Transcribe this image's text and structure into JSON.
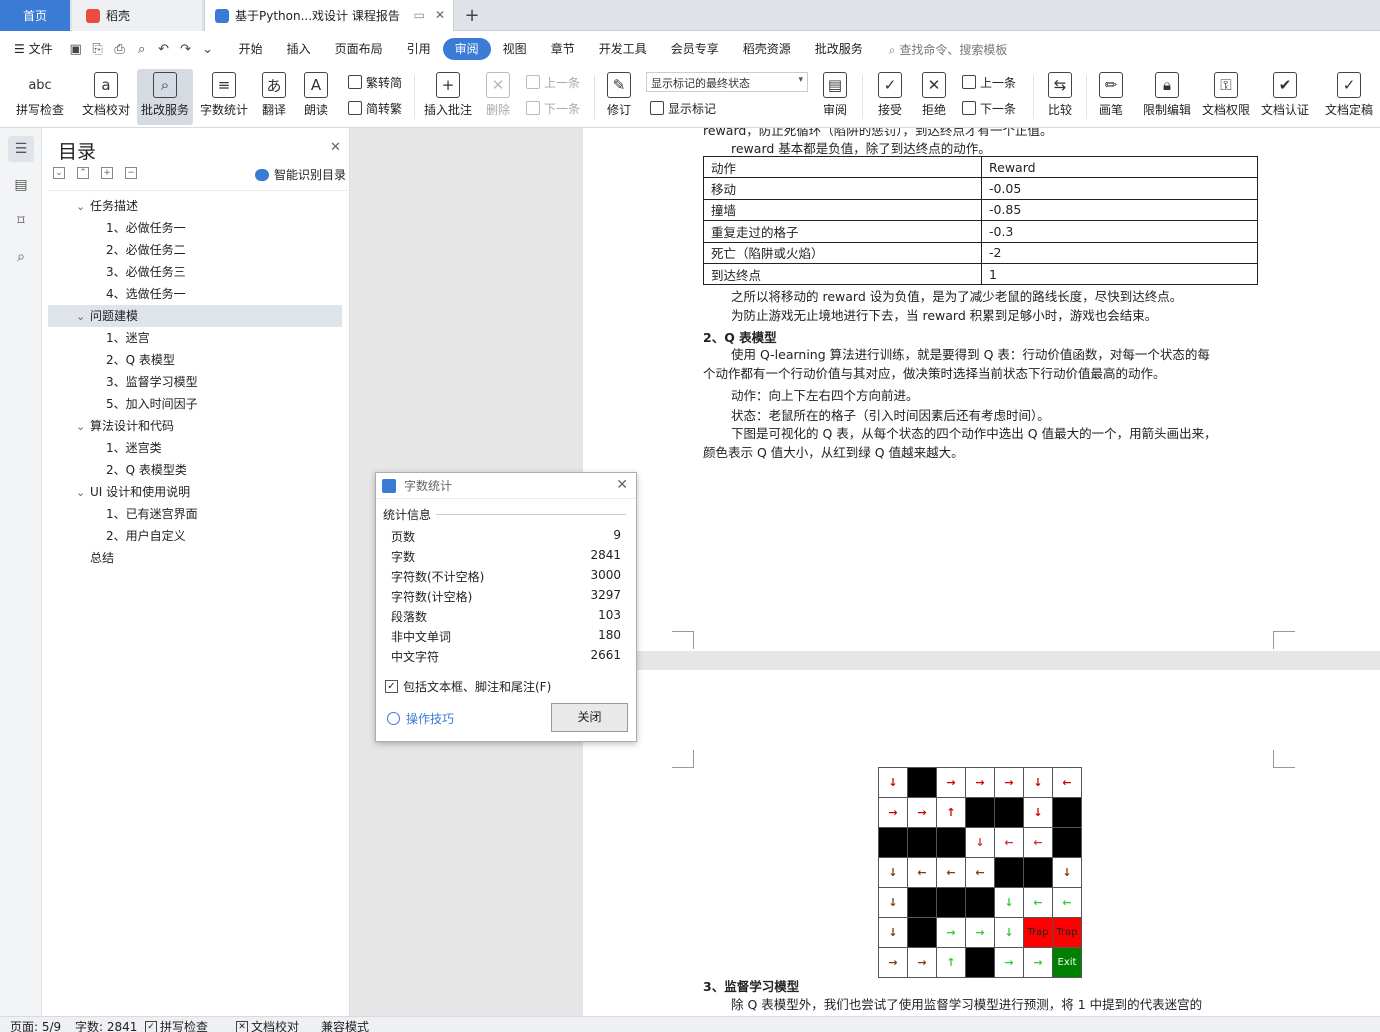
{
  "tabs": {
    "home": "首页",
    "daoke": "稻壳",
    "doc": "基于Python...戏设计 课程报告"
  },
  "menu": {
    "file": "文件",
    "items": [
      "开始",
      "插入",
      "页面布局",
      "引用",
      "审阅",
      "视图",
      "章节",
      "开发工具",
      "会员专享",
      "稻壳资源",
      "批改服务"
    ],
    "active": "审阅",
    "search": "查找命令、搜索模板"
  },
  "ribbon": {
    "spell": "拼写检查",
    "proof": "文档校对",
    "correct": "批改服务",
    "wordcount": "字数统计",
    "translate": "翻译",
    "read": "朗读",
    "trad": "繁转简",
    "simp": "简转繁",
    "insert_comment": "插入批注",
    "delete": "删除",
    "prev_comment": "上一条",
    "next_comment": "下一条",
    "track": "修订",
    "markup_select": "显示标记的最终状态",
    "show_markup": "显示标记",
    "review": "审阅",
    "accept": "接受",
    "reject": "拒绝",
    "prev": "上一条",
    "next": "下一条",
    "compare": "比较",
    "pen": "画笔",
    "restrict": "限制编辑",
    "perm": "文档权限",
    "cert": "文档认证",
    "final": "文档定稿"
  },
  "toc": {
    "title": "目录",
    "smart": "智能识别目录",
    "items": [
      {
        "label": "任务描述",
        "level": 1
      },
      {
        "label": "1、必做任务一",
        "level": 2
      },
      {
        "label": "2、必做任务二",
        "level": 2
      },
      {
        "label": "3、必做任务三",
        "level": 2
      },
      {
        "label": "4、选做任务一",
        "level": 2
      },
      {
        "label": "问题建模",
        "level": 1
      },
      {
        "label": "1、迷宫",
        "level": 2
      },
      {
        "label": "2、Q 表模型",
        "level": 2
      },
      {
        "label": "3、监督学习模型",
        "level": 2
      },
      {
        "label": "5、加入时间因子",
        "level": 2
      },
      {
        "label": "算法设计和代码",
        "level": 1
      },
      {
        "label": "1、迷宫类",
        "level": 2
      },
      {
        "label": "2、Q 表模型类",
        "level": 2
      },
      {
        "label": "UI 设计和使用说明",
        "level": 1
      },
      {
        "label": "1、已有迷宫界面",
        "level": 2
      },
      {
        "label": "2、用户自定义",
        "level": 2
      },
      {
        "label": "总结",
        "level": 0
      }
    ]
  },
  "doc": {
    "cut_line": "reward，防止死循环（陷阱的惩罚），到达终点才有一个正值。",
    "line1": "reward 基本都是负值，除了到达终点的动作。",
    "table": [
      [
        "动作",
        "Reward"
      ],
      [
        "移动",
        "-0.05"
      ],
      [
        "撞墙",
        "-0.85"
      ],
      [
        "重复走过的格子",
        "-0.3"
      ],
      [
        "死亡（陷阱或火焰）",
        "-2"
      ],
      [
        "到达终点",
        "1"
      ]
    ],
    "p_after_table": "之所以将移动的 reward 设为负值，是为了减少老鼠的路线长度，尽快到达终点。",
    "p_loop": "为防止游戏无止境地进行下去，当 reward 积累到足够小时，游戏也会结束。",
    "h2": "2、Q 表模型",
    "q1a": "使用 Q-learning 算法进行训练，就是要得到 Q 表：行动价值函数，对每一个状态的每",
    "q1b": "个动作都有一个行动价值与其对应，做决策时选择当前状态下行动价值最高的动作。",
    "q2": "动作：向上下左右四个方向前进。",
    "q3": "状态：老鼠所在的格子（引入时间因素后还有考虑时间）。",
    "q4a": "下图是可视化的 Q 表，从每个状态的四个动作中选出 Q 值最大的一个，用箭头画出来，",
    "q4b": "颜色表示 Q 值大小，从红到绿 Q 值越来越大。",
    "h3": "3、监督学习模型",
    "last": "除 Q 表模型外，我们也尝试了使用监督学习模型进行预测，将 1 中提到的代表迷宫的"
  },
  "maze": {
    "trap_label": "Trap",
    "exit_label": "Exit",
    "rows": [
      [
        [
          "↓",
          "#c00"
        ],
        [
          "W"
        ],
        [
          "→",
          "#c00"
        ],
        [
          "→",
          "#c00"
        ],
        [
          "→",
          "#c00"
        ],
        [
          "↓",
          "#c00"
        ],
        [
          "←",
          "#c00"
        ]
      ],
      [
        [
          "→",
          "#c00"
        ],
        [
          "→",
          "#c00"
        ],
        [
          "↑",
          "#c00"
        ],
        [
          "W"
        ],
        [
          "W"
        ],
        [
          "↓",
          "#c00"
        ],
        [
          "W"
        ]
      ],
      [
        [
          "W"
        ],
        [
          "W"
        ],
        [
          "W"
        ],
        [
          "↓",
          "#c33"
        ],
        [
          "←",
          "#c33"
        ],
        [
          "←",
          "#c33"
        ],
        [
          "W"
        ]
      ],
      [
        [
          "↓",
          "#8a3a00"
        ],
        [
          "←",
          "#8a3a00"
        ],
        [
          "←",
          "#8a3a00"
        ],
        [
          "←",
          "#8a3a00"
        ],
        [
          "W"
        ],
        [
          "W"
        ],
        [
          "↓",
          "#8a3a00"
        ]
      ],
      [
        [
          "↓",
          "#8a3a00"
        ],
        [
          "W"
        ],
        [
          "W"
        ],
        [
          "W"
        ],
        [
          "↓",
          "#3c3"
        ],
        [
          "←",
          "#3c3"
        ],
        [
          "←",
          "#3c3"
        ]
      ],
      [
        [
          "↓",
          "#8a3a00"
        ],
        [
          "W"
        ],
        [
          "→",
          "#3c3"
        ],
        [
          "→",
          "#3c3"
        ],
        [
          "↓",
          "#3c3"
        ],
        [
          "T"
        ],
        [
          "T"
        ]
      ],
      [
        [
          "→",
          "#8a3a00"
        ],
        [
          "→",
          "#8a3a00"
        ],
        [
          "↑",
          "#3c3"
        ],
        [
          "W"
        ],
        [
          "→",
          "#3c3"
        ],
        [
          "→",
          "#3c3"
        ],
        [
          "E"
        ]
      ]
    ]
  },
  "dialog": {
    "title": "字数统计",
    "group": "统计信息",
    "stats": [
      [
        "页数",
        "9"
      ],
      [
        "字数",
        "2841"
      ],
      [
        "字符数(不计空格)",
        "3000"
      ],
      [
        "字符数(计空格)",
        "3297"
      ],
      [
        "段落数",
        "103"
      ],
      [
        "非中文单词",
        "180"
      ],
      [
        "中文字符",
        "2661"
      ]
    ],
    "checkbox": "包括文本框、脚注和尾注(F)",
    "tips": "操作技巧",
    "close": "关闭"
  },
  "status": {
    "page": "页面: 5/9",
    "words": "字数: 2841",
    "spell": "拼写检查",
    "proof": "文档校对",
    "compat": "兼容模式"
  },
  "colors": {
    "accent": "#3a7bd5",
    "trap": "#ff0000",
    "exit": "#008000"
  }
}
